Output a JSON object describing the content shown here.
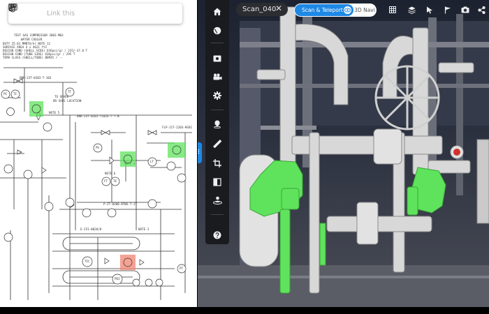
{
  "pid": {
    "header_lines": [
      "TEST GAS COMPRESSOR 3003-M03",
      "WATER COOLER",
      "DUTY                         25.01   MMBTU/hr NOTE 12",
      "SURFACE AREA                 4 x 4621 ft2",
      "DESIGN COND (SHELL SIDE)  636psi/gr / 235/-37.8 T",
      "DESIGN COND (TUBE SIDE)   636psi/gr / 295 T",
      "TEMA CLASS (SHELL/TUBE)    BEM45 / --"
    ],
    "line_labels": [
      "DNR-23T-0203-T-103",
      "DNR-23T-0201-T102G-T-T-N",
      "FLP-21T-2203-HSD1",
      "P-2T-0200-8TWS-T-1T",
      "E-251-0020/H"
    ],
    "note_labels": [
      "TO GRADE",
      "DR SAFE LOCATION",
      "NOTE 5",
      "NOTE 6",
      "NOTE 3",
      "NOTE 4"
    ],
    "instrument_tags": [
      "PI",
      "TI",
      "TT",
      "PG",
      "FT",
      "TE",
      "LT",
      "TIC",
      "PDI",
      "PT"
    ]
  },
  "toolbar": {
    "link_label": "Link this",
    "icons": [
      "drag-dots-icon",
      "link-icon",
      "square-icon",
      "share-nodes-icon",
      "hand-icon",
      "id-card-icon"
    ]
  },
  "viewer": {
    "scan_tab_label": "Scan_040",
    "scan_tab_close": "✕",
    "mode_scan_label": "Scan & Teleport",
    "mode_nav_label": "3D Navi",
    "top_tools": [
      "grid-icon",
      "layers-icon",
      "cursor-icon",
      "flag-icon",
      "camera-icon",
      "share-icon"
    ],
    "sidebar_tools": [
      "home-icon",
      "globe-icon",
      "view-settings-icon",
      "video-camera-icon",
      "gear-icon",
      "location-pin-icon",
      "ruler-icon",
      "crop-icon",
      "split-view-icon",
      "person-location-icon",
      "help-icon"
    ],
    "handle_glyph": "⠿"
  },
  "colors": {
    "accent": "#1e88e5",
    "highlight_green": "#5fe35c",
    "highlight_red": "#f28b79",
    "sidebar_bg": "#191b1f"
  }
}
